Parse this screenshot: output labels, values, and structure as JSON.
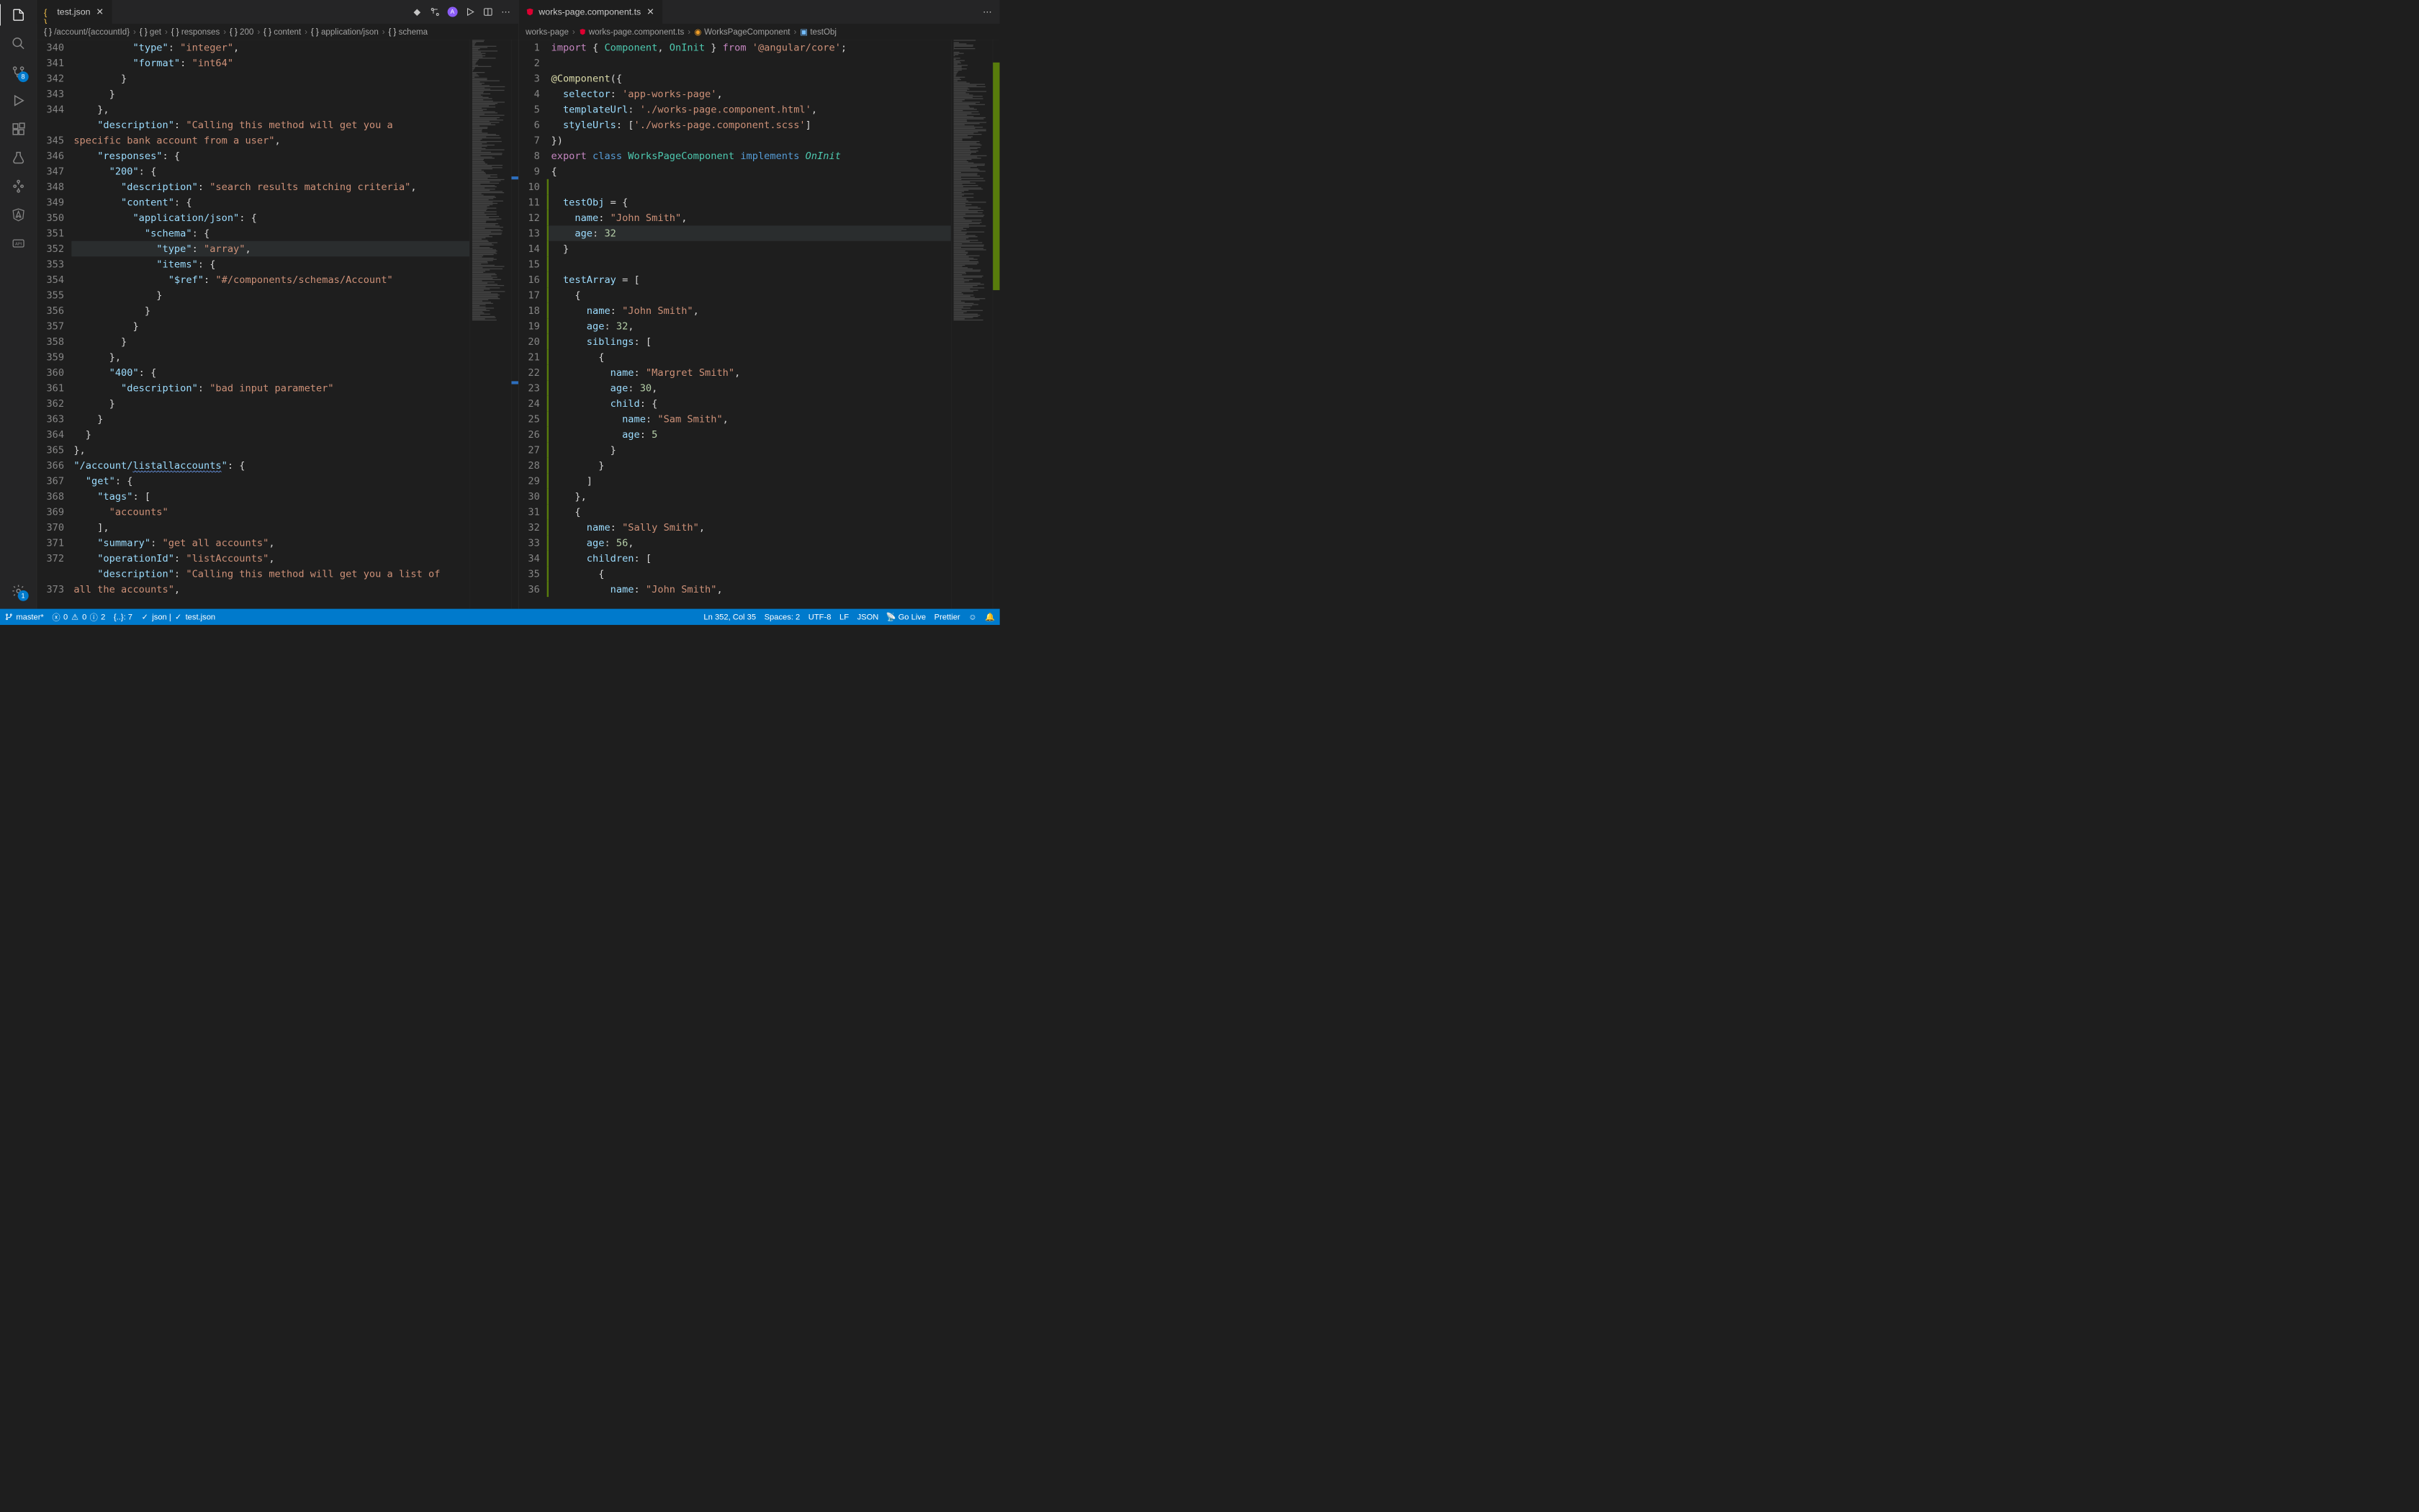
{
  "activity": {
    "scm_badge": "8",
    "settings_badge": "1"
  },
  "left": {
    "tab": {
      "label": "test.json"
    },
    "breadcrumb": [
      "/account/{accountId}",
      "get",
      "responses",
      "200",
      "content",
      "application/json",
      "schema"
    ],
    "gutter_start": 340,
    "lines": [
      [
        [
          "          ",
          ""
        ],
        [
          "\"type\"",
          "key"
        ],
        [
          ": ",
          "punct"
        ],
        [
          "\"integer\"",
          "str"
        ],
        [
          ",",
          "punct"
        ]
      ],
      [
        [
          "          ",
          ""
        ],
        [
          "\"format\"",
          "key"
        ],
        [
          ": ",
          "punct"
        ],
        [
          "\"int64\"",
          "str"
        ]
      ],
      [
        [
          "        }",
          "punct"
        ]
      ],
      [
        [
          "      }",
          "punct"
        ]
      ],
      [
        [
          "    },",
          "punct"
        ]
      ],
      [
        [
          "    ",
          ""
        ],
        [
          "\"description\"",
          "key"
        ],
        [
          ": ",
          "punct"
        ],
        [
          "\"Calling this method will get you a ",
          "str"
        ]
      ],
      [
        [
          "specific bank account from a user\"",
          "str"
        ],
        [
          ",",
          "punct"
        ]
      ],
      [
        [
          "    ",
          ""
        ],
        [
          "\"responses\"",
          "key"
        ],
        [
          ": {",
          "punct"
        ]
      ],
      [
        [
          "      ",
          ""
        ],
        [
          "\"200\"",
          "key"
        ],
        [
          ": {",
          "punct"
        ]
      ],
      [
        [
          "        ",
          ""
        ],
        [
          "\"description\"",
          "key"
        ],
        [
          ": ",
          "punct"
        ],
        [
          "\"search results matching criteria\"",
          "str"
        ],
        [
          ",",
          "punct"
        ]
      ],
      [
        [
          "        ",
          ""
        ],
        [
          "\"content\"",
          "key"
        ],
        [
          ": {",
          "punct"
        ]
      ],
      [
        [
          "          ",
          ""
        ],
        [
          "\"application/json\"",
          "key"
        ],
        [
          ": {",
          "punct"
        ]
      ],
      [
        [
          "            ",
          ""
        ],
        [
          "\"schema\"",
          "key"
        ],
        [
          ": {",
          "punct"
        ]
      ],
      [
        [
          "              ",
          ""
        ],
        [
          "\"type\"",
          "key"
        ],
        [
          ": ",
          "punct"
        ],
        [
          "\"array\"",
          "str"
        ],
        [
          ",",
          "punct"
        ]
      ],
      [
        [
          "              ",
          ""
        ],
        [
          "\"items\"",
          "key"
        ],
        [
          ": {",
          "punct"
        ]
      ],
      [
        [
          "                ",
          ""
        ],
        [
          "\"$ref\"",
          "key"
        ],
        [
          ": ",
          "punct"
        ],
        [
          "\"#/components/schemas/Account\"",
          "str"
        ]
      ],
      [
        [
          "              }",
          "punct"
        ]
      ],
      [
        [
          "            }",
          "punct"
        ]
      ],
      [
        [
          "          }",
          "punct"
        ]
      ],
      [
        [
          "        }",
          "punct"
        ]
      ],
      [
        [
          "      },",
          "punct"
        ]
      ],
      [
        [
          "      ",
          ""
        ],
        [
          "\"400\"",
          "key"
        ],
        [
          ": {",
          "punct"
        ]
      ],
      [
        [
          "        ",
          ""
        ],
        [
          "\"description\"",
          "key"
        ],
        [
          ": ",
          "punct"
        ],
        [
          "\"bad input parameter\"",
          "str"
        ]
      ],
      [
        [
          "      }",
          "punct"
        ]
      ],
      [
        [
          "    }",
          "punct"
        ]
      ],
      [
        [
          "  }",
          "punct"
        ]
      ],
      [
        [
          "},",
          "punct"
        ]
      ],
      [
        [
          "",
          ""
        ],
        [
          "\"/account/",
          "key"
        ],
        [
          "listallaccounts",
          "key underline"
        ],
        [
          "\"",
          "key"
        ],
        [
          ": {",
          "punct"
        ]
      ],
      [
        [
          "  ",
          ""
        ],
        [
          "\"get\"",
          "key"
        ],
        [
          ": {",
          "punct"
        ]
      ],
      [
        [
          "    ",
          ""
        ],
        [
          "\"tags\"",
          "key"
        ],
        [
          ": [",
          "punct"
        ]
      ],
      [
        [
          "      ",
          ""
        ],
        [
          "\"accounts\"",
          "str"
        ]
      ],
      [
        [
          "    ],",
          "punct"
        ]
      ],
      [
        [
          "    ",
          ""
        ],
        [
          "\"summary\"",
          "key"
        ],
        [
          ": ",
          "punct"
        ],
        [
          "\"get all accounts\"",
          "str"
        ],
        [
          ",",
          "punct"
        ]
      ],
      [
        [
          "    ",
          ""
        ],
        [
          "\"operationId\"",
          "key"
        ],
        [
          ": ",
          "punct"
        ],
        [
          "\"listAccounts\"",
          "str"
        ],
        [
          ",",
          "punct"
        ]
      ],
      [
        [
          "    ",
          ""
        ],
        [
          "\"description\"",
          "key"
        ],
        [
          ": ",
          "punct"
        ],
        [
          "\"Calling this method will get you a list of ",
          "str"
        ]
      ],
      [
        [
          "all the accounts\"",
          "str"
        ],
        [
          ",",
          "punct"
        ]
      ]
    ],
    "wrap_rows": {
      "5": true,
      "34": true
    }
  },
  "right": {
    "tab": {
      "label": "works-page.component.ts"
    },
    "breadcrumb_pre": "works-page",
    "breadcrumb": [
      "works-page.component.ts",
      "WorksPageComponent",
      "testObj"
    ],
    "gutter_start": 1,
    "lines": [
      [
        [
          "import",
          "kw"
        ],
        [
          " { ",
          "punct"
        ],
        [
          "Component",
          "class"
        ],
        [
          ", ",
          "punct"
        ],
        [
          "OnInit",
          "class"
        ],
        [
          " } ",
          "punct"
        ],
        [
          "from",
          "kw"
        ],
        [
          " ",
          "punct"
        ],
        [
          "'@angular/core'",
          "str"
        ],
        [
          ";",
          "punct"
        ]
      ],
      [
        [
          "",
          ""
        ]
      ],
      [
        [
          "@",
          "decor"
        ],
        [
          "Component",
          "decor"
        ],
        [
          "({",
          "punct"
        ]
      ],
      [
        [
          "  ",
          ""
        ],
        [
          "selector",
          "prop"
        ],
        [
          ": ",
          "punct"
        ],
        [
          "'app-works-page'",
          "str"
        ],
        [
          ",",
          "punct"
        ]
      ],
      [
        [
          "  ",
          ""
        ],
        [
          "templateUrl",
          "prop"
        ],
        [
          ": ",
          "punct"
        ],
        [
          "'./works-page.component.html'",
          "str"
        ],
        [
          ",",
          "punct"
        ]
      ],
      [
        [
          "  ",
          ""
        ],
        [
          "styleUrls",
          "prop"
        ],
        [
          ": [",
          "punct"
        ],
        [
          "'./works-page.component.scss'",
          "str"
        ],
        [
          "]",
          "punct"
        ]
      ],
      [
        [
          "})",
          "punct"
        ]
      ],
      [
        [
          "export",
          "kw"
        ],
        [
          " ",
          "punct"
        ],
        [
          "class",
          "kw2"
        ],
        [
          " ",
          "punct"
        ],
        [
          "WorksPageComponent",
          "class"
        ],
        [
          " ",
          "punct"
        ],
        [
          "implements",
          "kw2"
        ],
        [
          " ",
          "punct"
        ],
        [
          "OnInit",
          "type"
        ]
      ],
      [
        [
          "{",
          "punct"
        ]
      ],
      [
        [
          "",
          ""
        ]
      ],
      [
        [
          "  ",
          ""
        ],
        [
          "testObj",
          "prop"
        ],
        [
          " = {",
          "punct"
        ]
      ],
      [
        [
          "    ",
          ""
        ],
        [
          "name",
          "prop"
        ],
        [
          ": ",
          "punct"
        ],
        [
          "\"John Smith\"",
          "str"
        ],
        [
          ",",
          "punct"
        ]
      ],
      [
        [
          "    ",
          ""
        ],
        [
          "age",
          "prop"
        ],
        [
          ": ",
          "punct"
        ],
        [
          "32",
          "num"
        ]
      ],
      [
        [
          "  }",
          "punct"
        ]
      ],
      [
        [
          "",
          ""
        ]
      ],
      [
        [
          "  ",
          ""
        ],
        [
          "testArray",
          "prop"
        ],
        [
          " = [",
          "punct"
        ]
      ],
      [
        [
          "    {",
          "punct"
        ]
      ],
      [
        [
          "      ",
          ""
        ],
        [
          "name",
          "prop"
        ],
        [
          ": ",
          "punct"
        ],
        [
          "\"John Smith\"",
          "str"
        ],
        [
          ",",
          "punct"
        ]
      ],
      [
        [
          "      ",
          ""
        ],
        [
          "age",
          "prop"
        ],
        [
          ": ",
          "punct"
        ],
        [
          "32",
          "num"
        ],
        [
          ",",
          "punct"
        ]
      ],
      [
        [
          "      ",
          ""
        ],
        [
          "siblings",
          "prop"
        ],
        [
          ": [",
          "punct"
        ]
      ],
      [
        [
          "        {",
          "punct"
        ]
      ],
      [
        [
          "          ",
          ""
        ],
        [
          "name",
          "prop"
        ],
        [
          ": ",
          "punct"
        ],
        [
          "\"Margret Smith\"",
          "str"
        ],
        [
          ",",
          "punct"
        ]
      ],
      [
        [
          "          ",
          ""
        ],
        [
          "age",
          "prop"
        ],
        [
          ": ",
          "punct"
        ],
        [
          "30",
          "num"
        ],
        [
          ",",
          "punct"
        ]
      ],
      [
        [
          "          ",
          ""
        ],
        [
          "child",
          "prop"
        ],
        [
          ": {",
          "punct"
        ]
      ],
      [
        [
          "            ",
          ""
        ],
        [
          "name",
          "prop"
        ],
        [
          ": ",
          "punct"
        ],
        [
          "\"Sam Smith\"",
          "str"
        ],
        [
          ",",
          "punct"
        ]
      ],
      [
        [
          "            ",
          ""
        ],
        [
          "age",
          "prop"
        ],
        [
          ": ",
          "punct"
        ],
        [
          "5",
          "num"
        ]
      ],
      [
        [
          "          }",
          "punct"
        ]
      ],
      [
        [
          "        }",
          "punct"
        ]
      ],
      [
        [
          "      ]",
          "punct"
        ]
      ],
      [
        [
          "    },",
          "punct"
        ]
      ],
      [
        [
          "    {",
          "punct"
        ]
      ],
      [
        [
          "      ",
          ""
        ],
        [
          "name",
          "prop"
        ],
        [
          ": ",
          "punct"
        ],
        [
          "\"Sally Smith\"",
          "str"
        ],
        [
          ",",
          "punct"
        ]
      ],
      [
        [
          "      ",
          ""
        ],
        [
          "age",
          "prop"
        ],
        [
          ": ",
          "punct"
        ],
        [
          "56",
          "num"
        ],
        [
          ",",
          "punct"
        ]
      ],
      [
        [
          "      ",
          ""
        ],
        [
          "children",
          "prop"
        ],
        [
          ": [",
          "punct"
        ]
      ],
      [
        [
          "        {",
          "punct"
        ]
      ],
      [
        [
          "          ",
          ""
        ],
        [
          "name",
          "prop"
        ],
        [
          ": ",
          "punct"
        ],
        [
          "\"John Smith\"",
          "str"
        ],
        [
          ",",
          "punct"
        ]
      ]
    ],
    "current_line": 13
  },
  "statusbar": {
    "branch": "master*",
    "errors": "0",
    "warnings": "0",
    "info": "2",
    "bracket": "{..}: 7",
    "lang_left": "json  |",
    "file_left": "test.json",
    "cursor": "Ln 352, Col 35",
    "spaces": "Spaces: 2",
    "encoding": "UTF-8",
    "eol": "LF",
    "lang_right": "JSON",
    "golive": "Go Live",
    "prettier": "Prettier"
  }
}
